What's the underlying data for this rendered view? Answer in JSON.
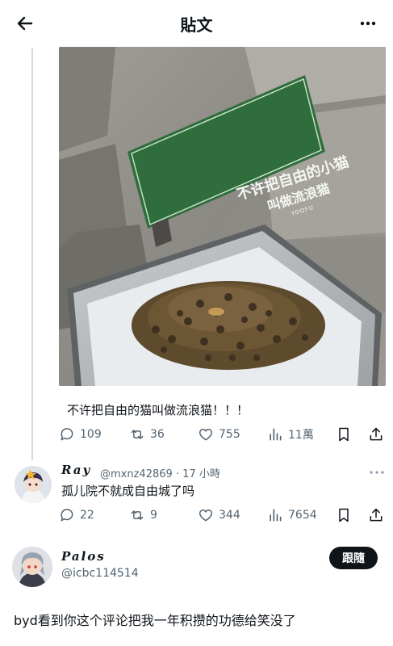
{
  "header": {
    "title": "貼文",
    "back_icon": "arrow-left-icon",
    "more_icon": "more-horizontal-icon"
  },
  "post": {
    "image": {
      "sign_line1": "不许把自由的小猫",
      "sign_line2": "叫做流浪猫",
      "sign_brand": "YOOFU"
    },
    "text": "不许把自由的猫叫做流浪猫！！！",
    "actions": {
      "replies": "109",
      "reposts": "36",
      "likes": "755",
      "views": "11萬"
    }
  },
  "reply1": {
    "name": "Ray",
    "handle": "@mxnz42869 · 17 小時",
    "text": "孤儿院不就成自由城了吗",
    "actions": {
      "replies": "22",
      "reposts": "9",
      "likes": "344",
      "views": "7654"
    }
  },
  "reply2": {
    "name": "Palos",
    "handle": "@icbc114514",
    "follow_label": "跟隨",
    "text": "byd看到你这个评论把我一年积攒的功德给笑没了"
  },
  "colors": {
    "text": "#0f1419",
    "secondary": "#536471",
    "thread_line": "#cfd9de",
    "sign_green": "#2f6e3c"
  }
}
